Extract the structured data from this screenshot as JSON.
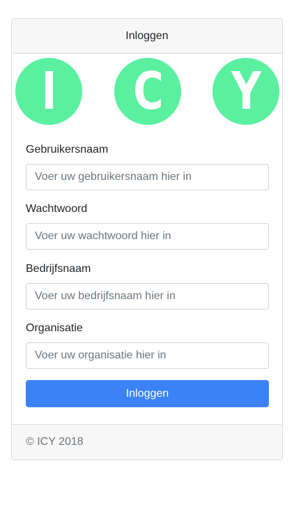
{
  "header": {
    "title": "Inloggen"
  },
  "logo": {
    "letters": [
      "I",
      "C",
      "Y"
    ],
    "color": "#5af0a0"
  },
  "form": {
    "username": {
      "label": "Gebruikersnaam",
      "placeholder": "Voer uw gebruikersnaam hier in"
    },
    "password": {
      "label": "Wachtwoord",
      "placeholder": "Voer uw wachtwoord hier in"
    },
    "company": {
      "label": "Bedrijfsnaam",
      "placeholder": "Voer uw bedrijfsnaam hier in"
    },
    "organisation": {
      "label": "Organisatie",
      "placeholder": "Voer uw organisatie hier in"
    },
    "submit_label": "Inloggen",
    "submit_color": "#3b82f6"
  },
  "footer": {
    "text": "© ICY 2018"
  }
}
